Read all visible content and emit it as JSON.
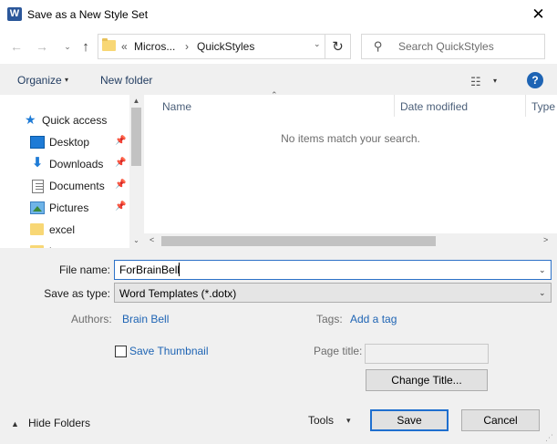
{
  "window": {
    "title": "Save as a New Style Set",
    "app_icon_letter": "W",
    "close_glyph": "✕"
  },
  "nav": {
    "back_glyph": "←",
    "forward_glyph": "→",
    "recent_glyph": "⌄",
    "up_glyph": "↑",
    "breadcrumb": [
      "«",
      "Micros...",
      "›",
      "QuickStyles"
    ],
    "dropdown_glyph": "⌄",
    "refresh_glyph": "↻",
    "search_placeholder": "Search QuickStyles",
    "search_glyph": "⚲"
  },
  "toolbar": {
    "organize_label": "Organize",
    "caret_glyph": "▾",
    "new_folder_label": "New folder",
    "view_glyph": "☷",
    "help_glyph": "?"
  },
  "navpane": {
    "items": [
      {
        "label": "Quick access",
        "icon": "star-icon",
        "glyph": "★"
      },
      {
        "label": "Desktop",
        "icon": "desktop-icon",
        "pinned": true
      },
      {
        "label": "Downloads",
        "icon": "download-icon",
        "glyph": "⬇",
        "pinned": true
      },
      {
        "label": "Documents",
        "icon": "document-icon",
        "pinned": true
      },
      {
        "label": "Pictures",
        "icon": "pictures-icon",
        "pinned": true
      },
      {
        "label": "excel",
        "icon": "folder-icon"
      },
      {
        "label": "l",
        "icon": "folder-icon"
      }
    ],
    "pin_glyph": "📌",
    "scroll_up_glyph": "▲",
    "scroll_down_glyph": "⌄"
  },
  "filelist": {
    "columns": [
      "Name",
      "Date modified",
      "Type"
    ],
    "sort_glyph": "⌃",
    "empty_message": "No items match your search.",
    "scroll_left_glyph": "<",
    "scroll_right_glyph": ">"
  },
  "form": {
    "file_name_label": "File name:",
    "file_name_value": "ForBrainBell",
    "save_type_label": "Save as type:",
    "save_type_value": "Word Templates (*.dotx)",
    "dropdown_glyph": "⌄",
    "authors_label": "Authors:",
    "authors_value": "Brain Bell",
    "tags_label": "Tags:",
    "tags_value": "Add a tag",
    "save_thumbnail_label": "Save Thumbnail",
    "page_title_label": "Page title:",
    "change_title_label": "Change Title..."
  },
  "footer": {
    "hide_folders_label": "Hide Folders",
    "hide_glyph": "▲",
    "tools_label": "Tools",
    "tools_caret": "▾",
    "save_label": "Save",
    "cancel_label": "Cancel",
    "grip_glyph": "⋰"
  }
}
